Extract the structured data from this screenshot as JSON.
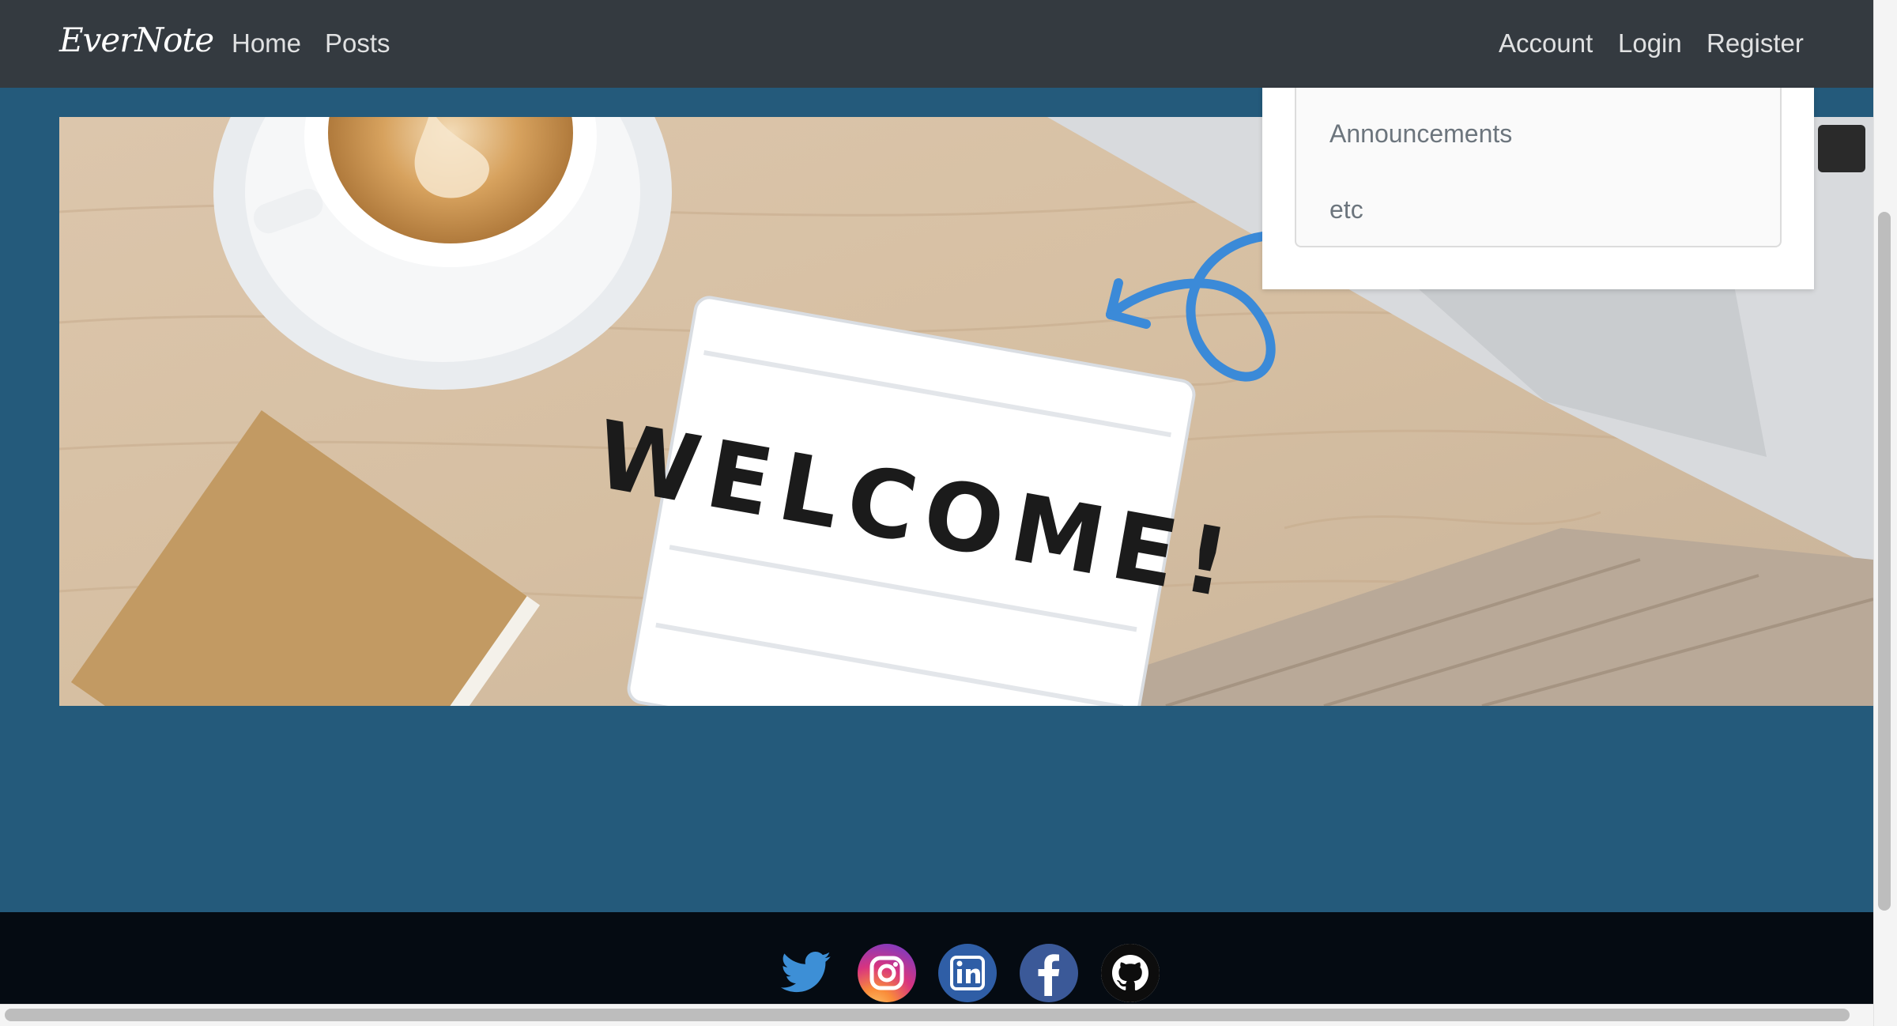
{
  "navbar": {
    "brand": "EverNote",
    "left_links": [
      "Home",
      "Posts"
    ],
    "right_links": [
      "Account",
      "Login",
      "Register"
    ]
  },
  "dropdown": {
    "items": [
      "Announcements",
      "etc"
    ]
  },
  "hero": {
    "sign_text": "WELCOME!"
  },
  "footer": {
    "social_icons": [
      "twitter-icon",
      "instagram-icon",
      "linkedin-icon",
      "facebook-icon",
      "github-icon"
    ]
  },
  "colors": {
    "navbar_bg": "#343a40",
    "main_bg": "#245a7b",
    "footer_bg": "#050b12"
  }
}
